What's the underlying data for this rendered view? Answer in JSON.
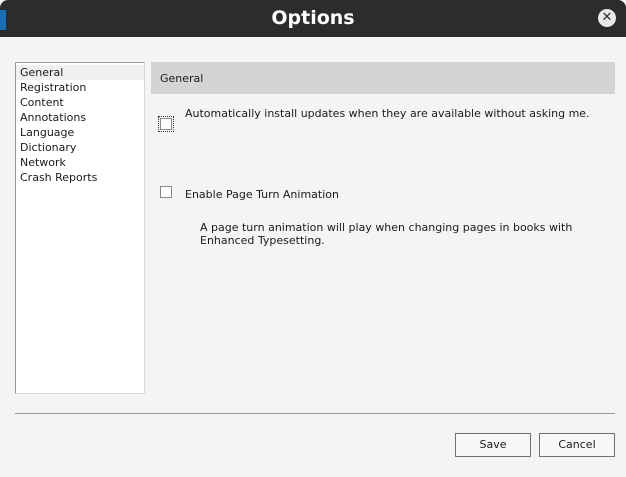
{
  "window": {
    "title": "Options"
  },
  "sidebar": {
    "items": [
      {
        "label": "General",
        "selected": true
      },
      {
        "label": "Registration"
      },
      {
        "label": "Content"
      },
      {
        "label": "Annotations"
      },
      {
        "label": "Language"
      },
      {
        "label": "Dictionary"
      },
      {
        "label": "Network"
      },
      {
        "label": "Crash Reports"
      }
    ]
  },
  "main": {
    "section_title": "General",
    "options": [
      {
        "label": "Automatically install updates when they are available without asking me.",
        "checked": false
      },
      {
        "label": "Enable Page Turn Animation",
        "checked": false,
        "description": "A page turn animation will play when changing pages in books with Enhanced Typesetting."
      }
    ]
  },
  "footer": {
    "save_label": "Save",
    "cancel_label": "Cancel"
  },
  "colors": {
    "titlebar": "#2c2c2c",
    "background": "#f4f4f4",
    "section_header": "#d4d4d4"
  },
  "icons": {
    "close": "close-icon"
  }
}
